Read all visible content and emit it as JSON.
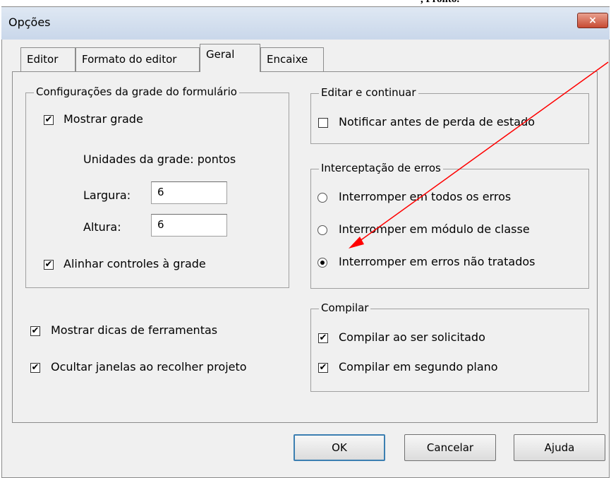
{
  "window": {
    "title": "Opções",
    "close_symbol": "×",
    "close_icon": "close-icon"
  },
  "background_text": {
    "fragment": ", Pronto."
  },
  "tabs": [
    {
      "label": "Editor"
    },
    {
      "label": "Formato do editor"
    },
    {
      "label": "Geral",
      "active": true
    },
    {
      "label": "Encaixe"
    }
  ],
  "grid_group": {
    "title": "Configurações da grade do formulário",
    "show_grid": {
      "label": "Mostrar grade",
      "checked": true
    },
    "units_label": "Unidades da grade: pontos",
    "width_label": "Largura:",
    "width_value": "6",
    "height_label": "Altura:",
    "height_value": "6",
    "align_controls": {
      "label": "Alinhar controles à grade",
      "checked": true
    }
  },
  "show_tooltips": {
    "label": "Mostrar dicas de ferramentas",
    "checked": true
  },
  "hide_windows": {
    "label": "Ocultar janelas ao recolher projeto",
    "checked": true
  },
  "edit_continue_group": {
    "title": "Editar e continuar",
    "notify": {
      "label": "Notificar antes de perda de estado",
      "checked": false
    }
  },
  "error_group": {
    "title": "Interceptação de erros",
    "options": [
      {
        "label": "Interromper em todos os erros",
        "selected": false
      },
      {
        "label": "Interromper em módulo de classe",
        "selected": false
      },
      {
        "label": "Interromper em erros não tratados",
        "selected": true
      }
    ]
  },
  "compile_group": {
    "title": "Compilar",
    "on_demand": {
      "label": "Compilar ao ser solicitado",
      "checked": true
    },
    "background": {
      "label": "Compilar em segundo plano",
      "checked": true
    }
  },
  "buttons": {
    "ok": "OK",
    "cancel": "Cancelar",
    "help": "Ajuda"
  },
  "check_mark": "✔",
  "colors": {
    "annotation_arrow": "#ff0000",
    "title_bar": "#c9d7ea",
    "close_button": "#c74a33",
    "dialog_background": "#f0f0f0"
  }
}
